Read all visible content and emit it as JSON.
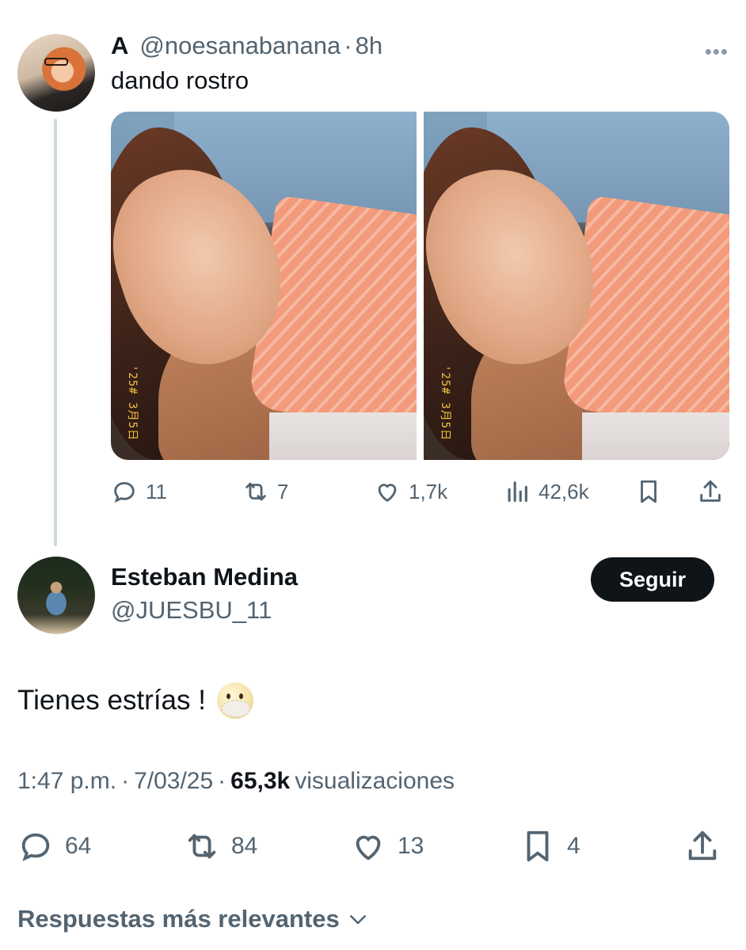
{
  "parent_tweet": {
    "display_name": "A",
    "handle": "@noesanabanana",
    "separator": "·",
    "time": "8h",
    "text": "dando rostro",
    "photo_stamp_1": "'25# 3月5日",
    "photo_stamp_2": "'25# 3月5日",
    "stats": {
      "replies": "11",
      "reposts": "7",
      "likes": "1,7k",
      "views": "42,6k"
    }
  },
  "reply_tweet": {
    "display_name": "Esteban Medina",
    "handle": "@JUESBU_11",
    "follow_label": "Seguir",
    "text": "Tienes estrías !",
    "time": "1:47 p.m.",
    "separator": "·",
    "date": "7/03/25",
    "views_count": "65,3k",
    "views_label": "visualizaciones",
    "stats": {
      "replies": "64",
      "reposts": "84",
      "likes": "13",
      "bookmarks": "4"
    }
  },
  "replies_section": {
    "label": "Respuestas más relevantes"
  },
  "icons": {
    "more": "more-icon",
    "reply": "reply-icon",
    "repost": "repost-icon",
    "like": "heart-icon",
    "views": "views-icon",
    "bookmark": "bookmark-icon",
    "share": "share-icon",
    "chevron": "chevron-down-icon"
  },
  "colors": {
    "text": "#0f1419",
    "secondary": "#536471",
    "thread_line": "#cfd9de",
    "follow_bg": "#0f1419"
  }
}
